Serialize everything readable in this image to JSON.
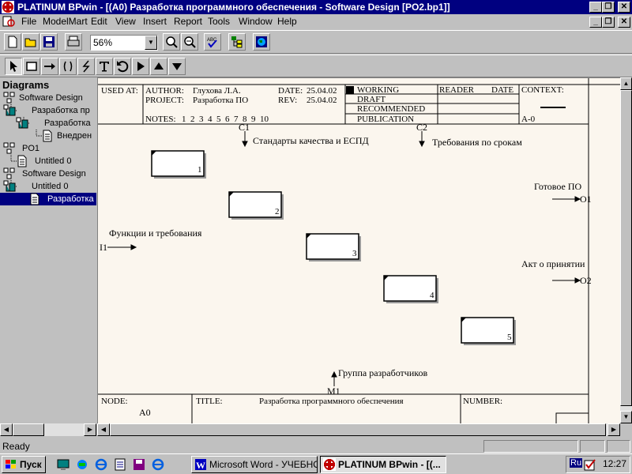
{
  "window": {
    "title": "PLATINUM BPwin - [(A0) Разработка программного обеспечения - Software Design   [PO2.bp1]]",
    "caption_buttons": [
      "_",
      "❐",
      "✕"
    ]
  },
  "menu": [
    "File",
    "ModelMart",
    "Edit",
    "View",
    "Insert",
    "Report",
    "Tools",
    "Window",
    "Help"
  ],
  "toolbar": {
    "zoom_value": "56%"
  },
  "tree": {
    "heading": "Diagrams",
    "items": [
      {
        "label": "Software Design"
      },
      {
        "label": "Разработка пр"
      },
      {
        "label": "Разработка"
      },
      {
        "label": "Внедрен"
      },
      {
        "label": "PO1"
      },
      {
        "label": "Untitled 0"
      },
      {
        "label": "Software Design"
      },
      {
        "label": "Untitled 0"
      },
      {
        "label": "Разработка"
      }
    ]
  },
  "header": {
    "used_at": "USED AT:",
    "author_label": "AUTHOR:",
    "author": "Глухова Л.А.",
    "project_label": "PROJECT:",
    "project": "Разработка ПО",
    "date_label": "DATE:",
    "date": "25.04.02",
    "rev_label": "REV:",
    "rev": "25.04.02",
    "notes_label": "NOTES:",
    "notes": "1  2  3  4  5  6  7  8  9  10",
    "status": [
      "WORKING",
      "DRAFT",
      "RECOMMENDED",
      "PUBLICATION"
    ],
    "reader": "READER",
    "date2": "DATE",
    "context": "CONTEXT:",
    "context_node": "A-0"
  },
  "arrows": {
    "c1": {
      "code": "C1",
      "label": "Стандарты качества и ЕСПД"
    },
    "c2": {
      "code": "C2",
      "label": "Требования по срокам"
    },
    "i1": {
      "code": "I1",
      "label": "Функции и требования"
    },
    "o1": {
      "code": "O1",
      "label": "Готовое ПО"
    },
    "o2": {
      "code": "O2",
      "label": "Акт о принятии"
    },
    "m1": {
      "code": "M1",
      "label": "Группа разработчиков"
    }
  },
  "boxes": [
    "1",
    "2",
    "3",
    "4",
    "5"
  ],
  "footer": {
    "node_label": "NODE:",
    "node": "A0",
    "title_label": "TITLE:",
    "title": "Разработка программного обеспечения",
    "number_label": "NUMBER:"
  },
  "status_bar": {
    "text": "Ready"
  },
  "taskbar": {
    "start": "Пуск",
    "tasks": [
      "Microsoft Word - УЧЕБНО...",
      "PLATINUM BPwin - [(..."
    ],
    "lang": "Ru",
    "clock": "12:27"
  },
  "colors": {
    "titlebar": "#000080",
    "canvas": "#fbf6ee",
    "selection": "#000080"
  }
}
